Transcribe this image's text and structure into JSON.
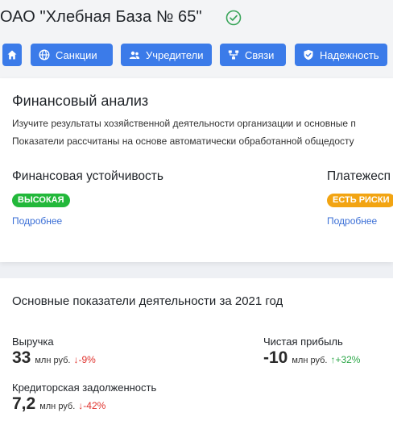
{
  "header": {
    "company_name": "ОАО \"Хлебная База № 65\""
  },
  "nav": {
    "sanctions": "Санкции",
    "founders": "Учредители",
    "links": "Связи",
    "reliability": "Надежность"
  },
  "financial": {
    "title": "Финансовый анализ",
    "desc_line1": "Изучите результаты хозяйственной деятельности организации и основные п",
    "desc_line2": "Показатели рассчитаны на основе автоматически обработанной общедосту",
    "stability": {
      "label": "Финансовая устойчивость",
      "badge": "ВЫСОКАЯ",
      "badge_color": "#22b83a",
      "more": "Подробнее"
    },
    "solvency": {
      "label": "Платежесп",
      "badge": "ЕСТЬ РИСКИ",
      "badge_color": "#f2a412",
      "more": "Подробнее"
    }
  },
  "indicators": {
    "title": "Основные показатели деятельности за 2021 год",
    "revenue": {
      "label": "Выручка",
      "value": "33",
      "unit": "млн руб.",
      "change": "↓-9%"
    },
    "net_profit": {
      "label": "Чистая прибыль",
      "value": "-10",
      "unit": "млн руб.",
      "change": "↑+32%"
    },
    "payables": {
      "label": "Кредиторская задолженность",
      "value": "7,2",
      "unit": "млн руб.",
      "change": "↓-42%"
    }
  },
  "colors": {
    "accent": "#3b7be9",
    "link": "#3b6fd6",
    "negative": "#e0322d",
    "positive": "#2ea84a",
    "verified": "#3aa55a"
  },
  "icons": {
    "verified": "check-circle-icon",
    "home": "home-icon",
    "sanctions": "globe-icon",
    "founders": "users-icon",
    "links": "network-icon",
    "reliability": "shield-check-icon"
  }
}
